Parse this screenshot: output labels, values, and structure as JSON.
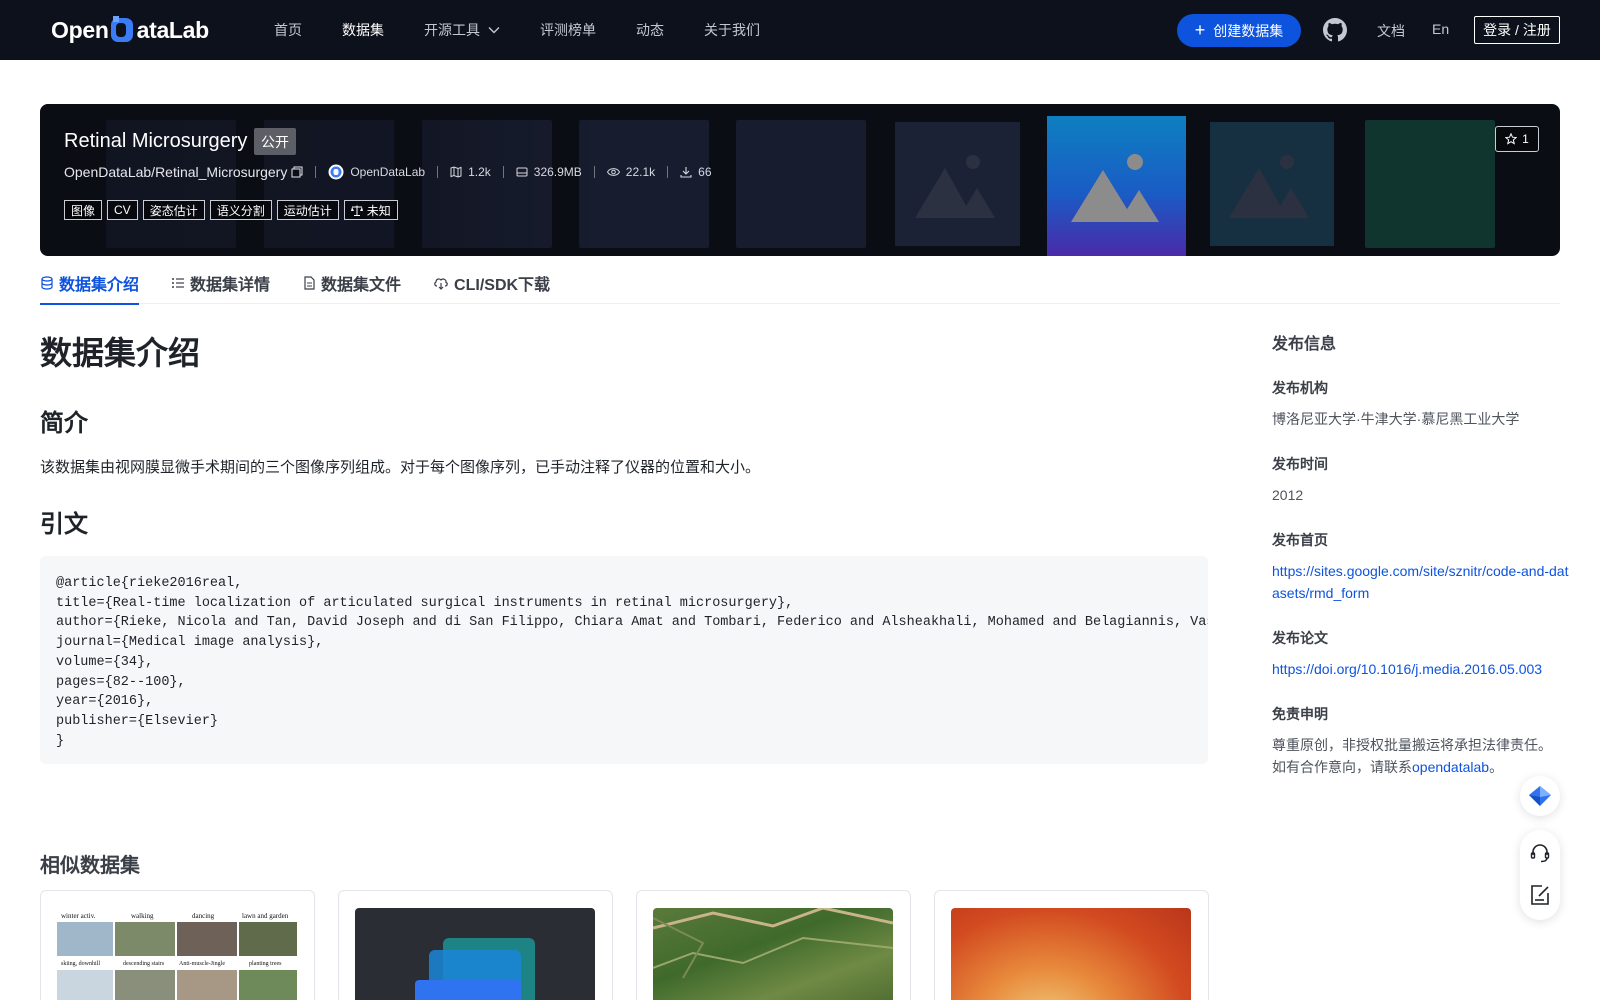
{
  "nav": {
    "logo_part1": "Open",
    "logo_part2": "ataLab",
    "links": [
      {
        "label": "首页"
      },
      {
        "label": "数据集"
      },
      {
        "label": "开源工具"
      },
      {
        "label": "评测榜单"
      },
      {
        "label": "动态"
      },
      {
        "label": "关于我们"
      }
    ],
    "create_label": "创建数据集",
    "docs_label": "文档",
    "lang_label": "En",
    "login_label": "登录 / 注册"
  },
  "banner": {
    "title": "Retinal Microsurgery",
    "visibility": "公开",
    "repo_path": "OpenDataLab/Retinal_Microsurgery",
    "publisher": "OpenDataLab",
    "likes": "1.2k",
    "size": "326.9MB",
    "views": "22.1k",
    "downloads": "66",
    "tags": [
      "图像",
      "CV",
      "姿态估计",
      "语义分割",
      "运动估计",
      "未知"
    ],
    "stars": "1"
  },
  "tabs": [
    {
      "label": "数据集介绍",
      "icon": "database-icon"
    },
    {
      "label": "数据集详情",
      "icon": "list-icon"
    },
    {
      "label": "数据集文件",
      "icon": "file-icon"
    },
    {
      "label": "CLI/SDK下载",
      "icon": "cloud-download-icon"
    }
  ],
  "content": {
    "heading": "数据集介绍",
    "intro_heading": "简介",
    "intro_text": "该数据集由视网膜显微手术期间的三个图像序列组成。对于每个图像序列，已手动注释了仪器的位置和大小。",
    "citation_heading": "引文",
    "citation": "@article{rieke2016real,\ntitle={Real-time localization of articulated surgical instruments in retinal microsurgery},\nauthor={Rieke, Nicola and Tan, David Joseph and di San Filippo, Chiara Amat and Tombari, Federico and Alsheakhali, Mohamed and Belagiannis, Vasileios and Eslami, Abouzar and Navab, Nassir},\njournal={Medical image analysis},\nvolume={34},\npages={82--100},\nyear={2016},\npublisher={Elsevier}\n}",
    "similar_heading": "相似数据集"
  },
  "similar_thumbs": {
    "card1_headers": [
      "winter activ.",
      "walking",
      "dancing",
      "lawn and garden"
    ],
    "card1_subheaders": [
      "skiing, downhill",
      "descending stairs",
      "Anti-muscle-Jingle",
      "planting trees"
    ]
  },
  "sidebar": {
    "title": "发布信息",
    "org_label": "发布机构",
    "org_value": "博洛尼亚大学·牛津大学·慕尼黑工业大学",
    "time_label": "发布时间",
    "time_value": "2012",
    "home_label": "发布首页",
    "home_value": "https://sites.google.com/site/sznitr/code-and-datasets/rmd_form",
    "paper_label": "发布论文",
    "paper_value": "https://doi.org/10.1016/j.media.2016.05.003",
    "disclaimer_label": "免责申明",
    "disclaimer_line1": "尊重原创，非授权批量搬运将承担法律责任。",
    "disclaimer_line2_prefix": "如有合作意向，请联系",
    "disclaimer_link": "opendatalab",
    "disclaimer_suffix": "。"
  }
}
